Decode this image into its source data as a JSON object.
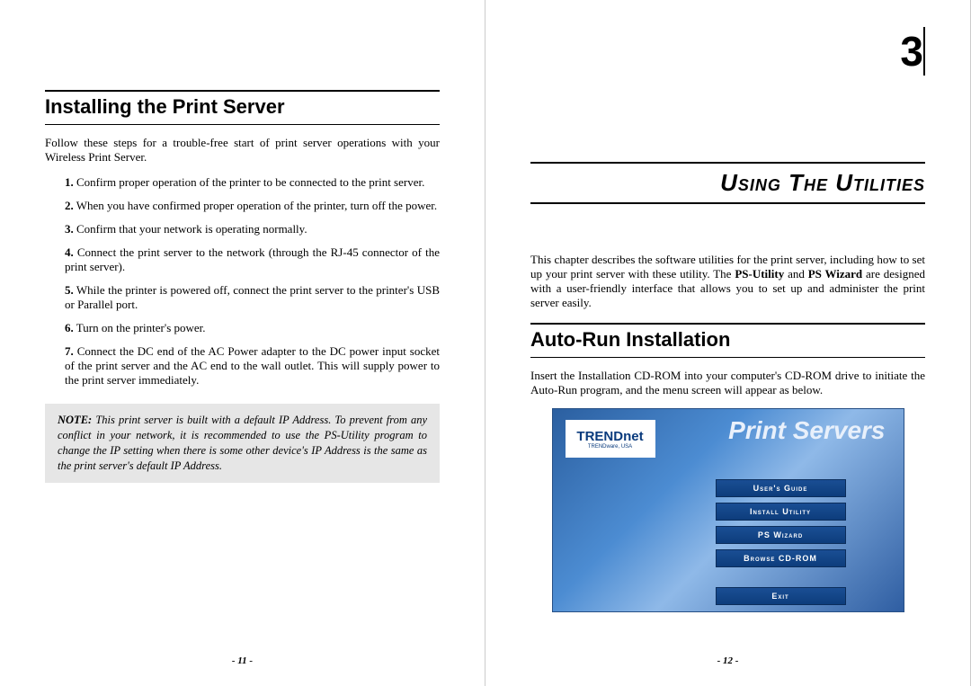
{
  "left": {
    "heading": "Installing the Print Server",
    "intro": "Follow these steps for a trouble-free start of print server operations with your Wireless Print Server.",
    "steps": [
      "Confirm proper operation of the printer to be connected to the print server.",
      "When you have confirmed proper operation of the printer, turn off the power.",
      "Confirm that your network is operating normally.",
      "Connect the print server to the network (through the RJ-45 connector of the print server).",
      "While the printer is powered off, connect the print server to the printer's USB or Parallel port.",
      "Turn on the printer's power.",
      "Connect the DC end of the AC Power adapter to the DC power input socket of the print server and the AC end to the wall outlet. This will supply power to the print server immediately."
    ],
    "note_label": "NOTE:",
    "note": "This print server is built with a default IP Address.  To prevent from any conflict in your network, it is recommended to use the PS-Utility program to change the IP setting when there is some other device's IP Address is the same as the print server's default IP Address.",
    "page_num": "- 11 -"
  },
  "right": {
    "chapter_num": "3",
    "chapter_title": "Using  The  Utilities",
    "intro_a": "This chapter describes the software utilities for the print server, including how to set up your print server with these utility.   The ",
    "intro_b1": "PS-Utility",
    "intro_c": " and ",
    "intro_b2": "PS Wizard",
    "intro_d": " are designed with a user-friendly interface that allows you to set up and administer the print server easily.",
    "heading2": "Auto-Run Installation",
    "p2": "Insert the Installation CD-ROM into your computer's CD-ROM drive to initiate the Auto-Run program, and the menu screen will appear as below.",
    "page_num": "- 12 -",
    "cd": {
      "brand": "TRENDnet",
      "brand_sub": "TRENDware, USA",
      "title": "Print Servers",
      "buttons": [
        "User's Guide",
        "Install Utility",
        "PS Wizard",
        "Browse CD-ROM"
      ],
      "exit": "Exit"
    }
  }
}
